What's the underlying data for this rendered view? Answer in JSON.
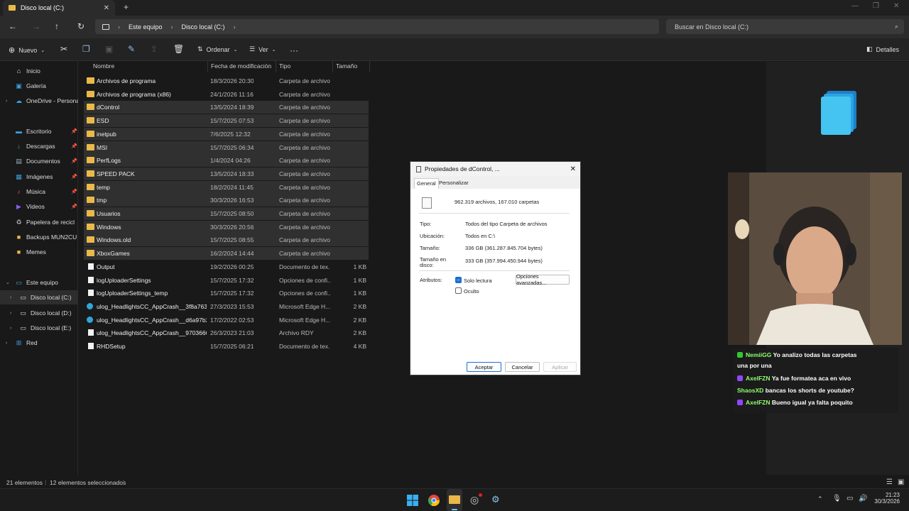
{
  "window": {
    "tab_title": "Disco local (C:)",
    "tab_close": "✕",
    "new_tab": "+"
  },
  "address": {
    "segments": [
      "Este equipo",
      "Disco local (C:)"
    ],
    "search_placeholder": "Buscar en Disco local (C:)"
  },
  "toolbar": {
    "new_label": "Nuevo",
    "sort_label": "Ordenar",
    "view_label": "Ver",
    "more_label": "···",
    "details_label": "Detalles"
  },
  "sidebar": {
    "items": [
      {
        "label": "Inicio",
        "icon": "home-icon"
      },
      {
        "label": "Galería",
        "icon": "gallery-icon"
      },
      {
        "label": "OneDrive - Personal",
        "icon": "cloud-icon"
      },
      {
        "label": "Escritorio",
        "icon": "desktop-icon"
      },
      {
        "label": "Descargas",
        "icon": "download-icon"
      },
      {
        "label": "Documentos",
        "icon": "documents-icon"
      },
      {
        "label": "Imágenes",
        "icon": "pictures-icon"
      },
      {
        "label": "Música",
        "icon": "music-icon"
      },
      {
        "label": "Videos",
        "icon": "video-icon"
      },
      {
        "label": "Papelera de recicl",
        "icon": "recycle-bin-icon"
      },
      {
        "label": "Backups MUN2CU",
        "icon": "folder-icon"
      },
      {
        "label": "Memes",
        "icon": "folder-icon"
      },
      {
        "label": "Este equipo",
        "icon": "computer-icon"
      },
      {
        "label": "Disco local (C:)",
        "icon": "drive-icon"
      },
      {
        "label": "Disco local (D:)",
        "icon": "drive-icon"
      },
      {
        "label": "Disco local (E:)",
        "icon": "drive-icon"
      },
      {
        "label": "Red",
        "icon": "network-icon"
      }
    ]
  },
  "list": {
    "headers": {
      "name": "Nombre",
      "date": "Fecha de modificación",
      "type": "Tipo",
      "size": "Tamaño"
    },
    "rows": [
      {
        "name": "Archivos de programa",
        "date": "18/3/2026 20:30",
        "type": "Carpeta de archivos",
        "size": "",
        "kind": "folder",
        "selected": false
      },
      {
        "name": "Archivos de programa (x86)",
        "date": "24/1/2026 11:16",
        "type": "Carpeta de archivos",
        "size": "",
        "kind": "folder",
        "selected": false
      },
      {
        "name": "dControl",
        "date": "13/5/2024 18:39",
        "type": "Carpeta de archivos",
        "size": "",
        "kind": "folder",
        "selected": true
      },
      {
        "name": "ESD",
        "date": "15/7/2025 07:53",
        "type": "Carpeta de archivos",
        "size": "",
        "kind": "folder",
        "selected": true
      },
      {
        "name": "inetpub",
        "date": "7/6/2025 12:32",
        "type": "Carpeta de archivos",
        "size": "",
        "kind": "folder",
        "selected": true
      },
      {
        "name": "MSI",
        "date": "15/7/2025 06:34",
        "type": "Carpeta de archivos",
        "size": "",
        "kind": "folder",
        "selected": true
      },
      {
        "name": "PerfLogs",
        "date": "1/4/2024 04:26",
        "type": "Carpeta de archivos",
        "size": "",
        "kind": "folder",
        "selected": true
      },
      {
        "name": "SPEED PACK",
        "date": "13/5/2024 18:33",
        "type": "Carpeta de archivos",
        "size": "",
        "kind": "folder",
        "selected": true
      },
      {
        "name": "temp",
        "date": "18/2/2024 11:45",
        "type": "Carpeta de archivos",
        "size": "",
        "kind": "folder",
        "selected": true
      },
      {
        "name": "tmp",
        "date": "30/3/2026 16:53",
        "type": "Carpeta de archivos",
        "size": "",
        "kind": "folder",
        "selected": true
      },
      {
        "name": "Usuarios",
        "date": "15/7/2025 08:50",
        "type": "Carpeta de archivos",
        "size": "",
        "kind": "folder",
        "selected": true
      },
      {
        "name": "Windows",
        "date": "30/3/2026 20:56",
        "type": "Carpeta de archivos",
        "size": "",
        "kind": "folder",
        "selected": true
      },
      {
        "name": "Windows.old",
        "date": "15/7/2025 08:55",
        "type": "Carpeta de archivos",
        "size": "",
        "kind": "folder",
        "selected": true
      },
      {
        "name": "XboxGames",
        "date": "16/2/2024 14:44",
        "type": "Carpeta de archivos",
        "size": "",
        "kind": "folder",
        "selected": true
      },
      {
        "name": "Output",
        "date": "19/2/2026 00:25",
        "type": "Documento de tex...",
        "size": "1 KB",
        "kind": "file",
        "selected": false
      },
      {
        "name": "logUploaderSettings",
        "date": "15/7/2025 17:32",
        "type": "Opciones de confi...",
        "size": "1 KB",
        "kind": "file",
        "selected": false
      },
      {
        "name": "logUploaderSettings_temp",
        "date": "15/7/2025 17:32",
        "type": "Opciones de confi...",
        "size": "1 KB",
        "kind": "file",
        "selected": false
      },
      {
        "name": "ulog_HeadlightsCC_AppCrash__3f8a7634...",
        "date": "27/3/2023 15:53",
        "type": "Microsoft Edge H...",
        "size": "2 KB",
        "kind": "edge",
        "selected": false
      },
      {
        "name": "ulog_HeadlightsCC_AppCrash__d6a97b2...",
        "date": "17/2/2022 02:53",
        "type": "Microsoft Edge H...",
        "size": "2 KB",
        "kind": "edge",
        "selected": false
      },
      {
        "name": "ulog_HeadlightsCC_AppCrash__97036660...",
        "date": "26/3/2023 21:03",
        "type": "Archivo RDY",
        "size": "2 KB",
        "kind": "file",
        "selected": false
      },
      {
        "name": "RHDSetup",
        "date": "15/7/2025 06:21",
        "type": "Documento de tex...",
        "size": "4 KB",
        "kind": "file",
        "selected": false
      }
    ]
  },
  "dialog": {
    "title": "Propiedades de dControl, ...",
    "tabs": [
      "General",
      "Personalizar"
    ],
    "summary": "962.319 archivos, 167.010 carpetas",
    "type_label": "Tipo:",
    "type_value": "Todos del tipo Carpeta de archivos",
    "location_label": "Ubicación:",
    "location_value": "Todos en C:\\",
    "size_label": "Tamaño:",
    "size_value": "336 GB (361.287.845.704 bytes)",
    "disk_label": "Tamaño en disco:",
    "disk_value": "333 GB (357.994.450.944 bytes)",
    "attr_label": "Atributos:",
    "readonly_label": "Solo lectura",
    "hidden_label": "Oculto",
    "advanced_label": "Opciones avanzadas...",
    "ok_label": "Aceptar",
    "cancel_label": "Cancelar",
    "apply_label": "Aplicar"
  },
  "status": {
    "count": "21 elementos",
    "selected": "12 elementos seleccionados"
  },
  "taskbar": {
    "time": "21:23",
    "date": "30/3/2026"
  },
  "chat": {
    "messages": [
      {
        "user": "NemiiGG",
        "text": "Yo analizo todas las carpetas",
        "text2": "una por una",
        "badge": "g"
      },
      {
        "user": "AxelFZN",
        "text": "Ya fue formatea aca en vivo",
        "badge": "p"
      },
      {
        "user": "ShaosXD",
        "text": "bancas los shorts de youtube?",
        "badge": ""
      },
      {
        "user": "AxelFZN",
        "text": "Bueno igual ya falta poquito",
        "badge": "p"
      }
    ]
  }
}
